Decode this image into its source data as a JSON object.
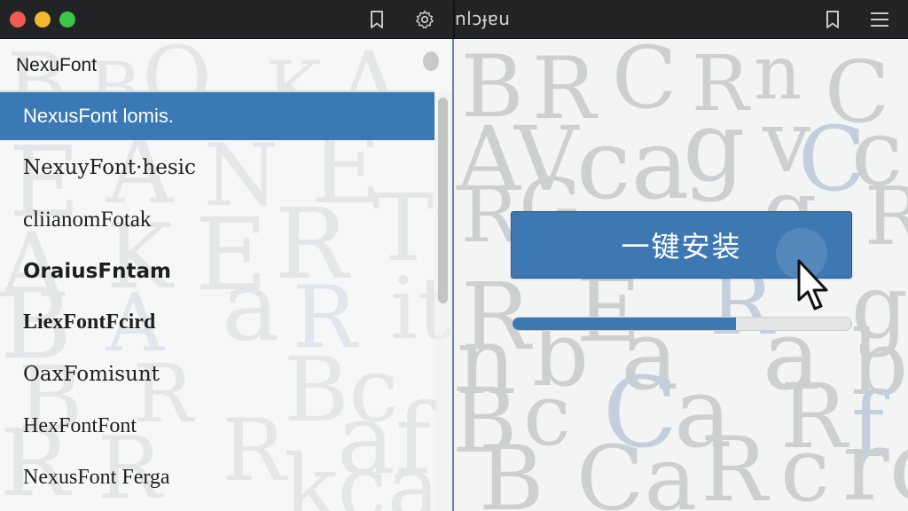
{
  "window": {
    "right_title": "nlɔɟɐu"
  },
  "sidebar": {
    "app_name": "NexuFont",
    "fonts": [
      {
        "name": "NexusFont lomis.",
        "selected": true
      },
      {
        "name": "NexuyFont·hesic",
        "selected": false
      },
      {
        "name": "cliianomFotak",
        "selected": false
      },
      {
        "name": "OraiusFntam",
        "selected": false
      },
      {
        "name": "LiexFontFcird",
        "selected": false
      },
      {
        "name": "OaxFomisunt",
        "selected": false
      },
      {
        "name": "HexFontFont",
        "selected": false
      },
      {
        "name": "NexusFont Ferga",
        "selected": false
      }
    ]
  },
  "main": {
    "install_button_label": "一键安装",
    "progress": 0.66
  },
  "colors": {
    "accent": "#3b79b6",
    "topbar": "#222324",
    "traffic_red": "#ee5b52",
    "traffic_yellow": "#f3b92e",
    "traffic_green": "#3cc546"
  },
  "icons": [
    "bookmark-icon",
    "gear-icon",
    "hamburger-menu-icon",
    "pointer-cursor-icon"
  ]
}
